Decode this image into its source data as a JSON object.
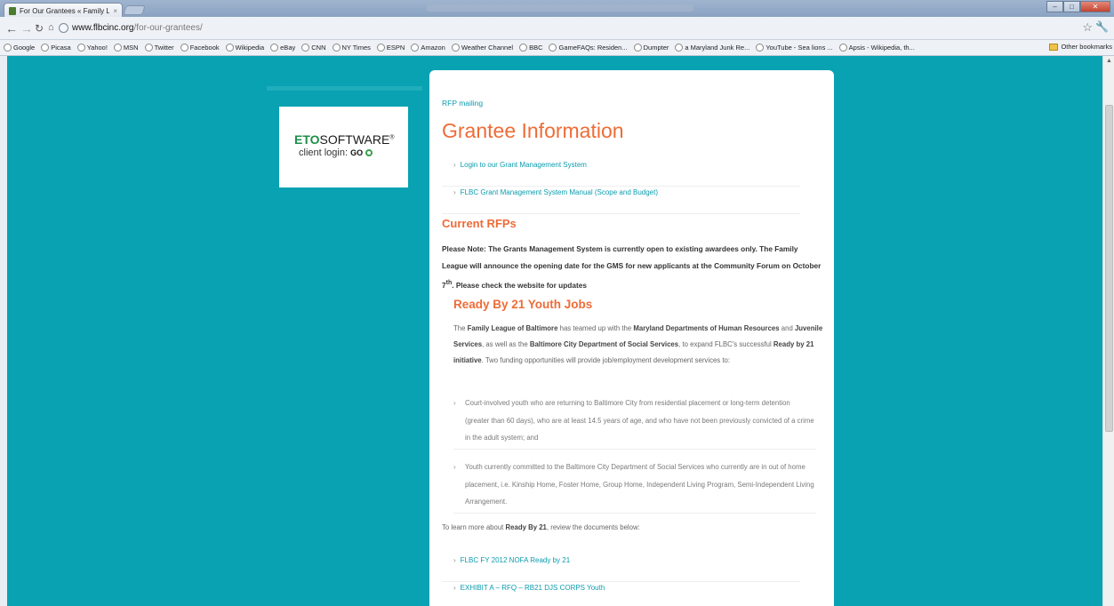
{
  "browser": {
    "tab_title": "For Our Grantees « Family L",
    "tab_close": "×",
    "url_host": "www.flbcinc.org",
    "url_path": "/for-our-grantees/",
    "bookmarks": [
      {
        "icon": "google-icon",
        "label": "Google"
      },
      {
        "icon": "globe-icon",
        "label": "Picasa"
      },
      {
        "icon": "globe-icon",
        "label": "Yahoo!"
      },
      {
        "icon": "globe-icon",
        "label": "MSN"
      },
      {
        "icon": "globe-icon",
        "label": "Twitter"
      },
      {
        "icon": "globe-icon",
        "label": "Facebook"
      },
      {
        "icon": "wikipedia-icon",
        "label": "Wikipedia"
      },
      {
        "icon": "ebay-icon",
        "label": "eBay"
      },
      {
        "icon": "globe-icon",
        "label": "CNN"
      },
      {
        "icon": "nytimes-icon",
        "label": "NY Times"
      },
      {
        "icon": "globe-icon",
        "label": "ESPN"
      },
      {
        "icon": "globe-icon",
        "label": "Amazon"
      },
      {
        "icon": "weather-icon",
        "label": "Weather Channel"
      },
      {
        "icon": "globe-icon",
        "label": "BBC"
      },
      {
        "icon": "gamefaqs-icon",
        "label": "GameFAQs: Residen..."
      },
      {
        "icon": "globe-icon",
        "label": "Dumpter"
      },
      {
        "icon": "person-icon",
        "label": "a Maryland Junk Re..."
      },
      {
        "icon": "youtube-icon",
        "label": "YouTube - Sea lions ..."
      },
      {
        "icon": "wikipedia-icon",
        "label": "Apsis - Wikipedia, th..."
      }
    ],
    "bookmarks_more": "»",
    "other_bookmarks": "Other bookmarks"
  },
  "sidebar": {
    "eto_brand_bold": "ETO",
    "eto_brand_rest": "SOFTWARE",
    "eto_reg": "®",
    "eto_login": "client login:",
    "eto_go": "GO"
  },
  "main": {
    "rfp_mailing": "RFP mailing",
    "title": "Grantee Information",
    "links": [
      "Login to our Grant Management System",
      "FLBC Grant Management System Manual (Scope and Budget)"
    ],
    "current_rfps": "Current RFPs",
    "note_p1": "Please Note: The Grants Management System is currently open to existing awardees only. The Family League will announce the opening date for the GMS for new applicants at the Community Forum on October 7",
    "note_sup": "th",
    "note_p2": ".  Please check the website for updates",
    "ready_heading": "Ready By 21 Youth Jobs",
    "intro": [
      "The ",
      "Family League of Baltimore",
      " has teamed up with the ",
      "Maryland Departments of Human Resources",
      " and ",
      "Juvenile Services",
      ", as well as the ",
      "Baltimore City Department of Social Services",
      ", to expand FLBC's successful ",
      "Ready by 21 initiative",
      ". Two funding opportunities will provide job/employment development services to:"
    ],
    "bullets": [
      "Court-involved youth who are returning to Baltimore City from residential placement or long-term detention (greater than 60 days), who are at least 14.5 years of age, and who have not been previously convicted of a crime in the adult system; and",
      "Youth currently committed to the Baltimore City Department of Social Services who currently are in out of home placement, i.e. Kinship Home, Foster Home, Group Home, Independent Living Program, Semi-Independent Living Arrangement."
    ],
    "learn_pre": "To learn more about ",
    "learn_bold": "Ready By 21",
    "learn_post": ", review the documents below:",
    "docs": [
      "FLBC FY 2012 NOFA Ready by 21",
      "EXHIBIT A – RFQ – RB21 DJS CORPS Youth"
    ]
  },
  "colors": {
    "page_bg": "#08a2b2",
    "accent_orange": "#ee6c37",
    "link_teal": "#0b9cad",
    "eto_green": "#1c8f4a"
  }
}
